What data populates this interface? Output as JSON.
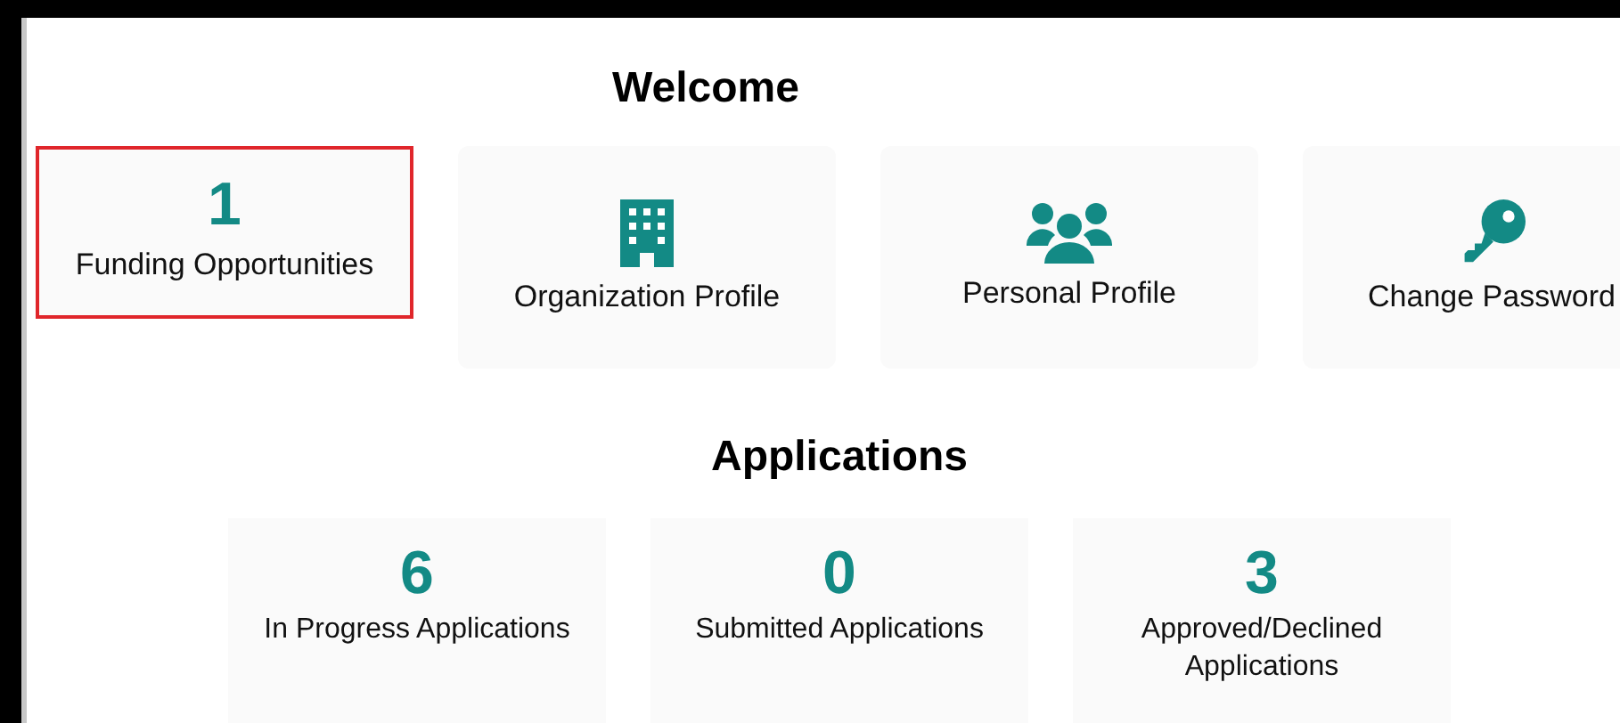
{
  "welcome": {
    "title": "Welcome"
  },
  "tiles": [
    {
      "kind": "count",
      "count": "1",
      "label": "Funding Opportunities",
      "selected": true
    },
    {
      "kind": "icon",
      "label": "Organization Profile",
      "selected": false
    },
    {
      "kind": "icon",
      "label": "Personal Profile",
      "selected": false
    },
    {
      "kind": "icon",
      "label": "Change Password",
      "selected": false
    }
  ],
  "applications": {
    "title": "Applications",
    "tiles": [
      {
        "count": "6",
        "label": "In Progress Applications"
      },
      {
        "count": "0",
        "label": "Submitted Applications"
      },
      {
        "count": "3",
        "label": "Approved/Declined Applications"
      }
    ]
  }
}
